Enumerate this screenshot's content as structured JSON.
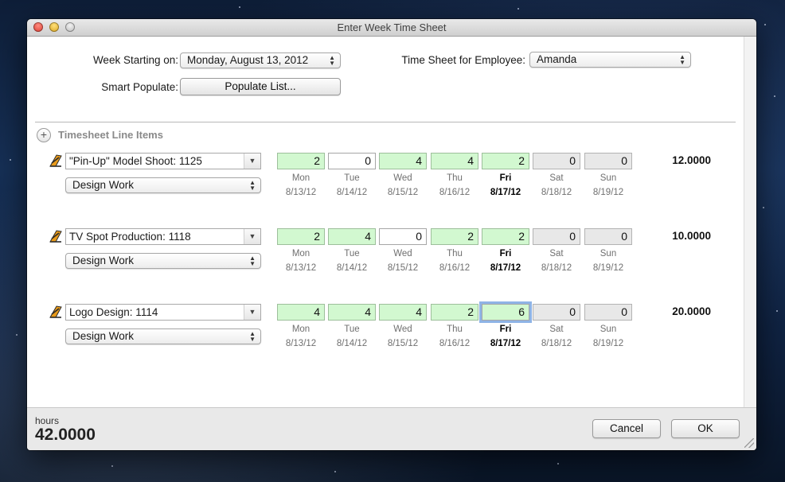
{
  "window": {
    "title": "Enter Week Time Sheet"
  },
  "header": {
    "week_label": "Week Starting on:",
    "week_value": "Monday, August 13, 2012",
    "employee_label": "Time Sheet for Employee:",
    "employee_value": "Amanda",
    "populate_label": "Smart Populate:",
    "populate_button": "Populate List..."
  },
  "section": {
    "title": "Timesheet Line Items"
  },
  "days": [
    {
      "day": "Mon",
      "date": "8/13/12"
    },
    {
      "day": "Tue",
      "date": "8/14/12"
    },
    {
      "day": "Wed",
      "date": "8/15/12"
    },
    {
      "day": "Thu",
      "date": "8/16/12"
    },
    {
      "day": "Fri",
      "date": "8/17/12"
    },
    {
      "day": "Sat",
      "date": "8/18/12"
    },
    {
      "day": "Sun",
      "date": "8/19/12"
    }
  ],
  "line_items": [
    {
      "project": "\"Pin-Up\" Model Shoot: 1125",
      "task": "Design Work",
      "hours": [
        "2",
        "0",
        "4",
        "4",
        "2",
        "0",
        "0"
      ],
      "total": "12.0000"
    },
    {
      "project": "TV Spot Production: 1118",
      "task": "Design Work",
      "hours": [
        "2",
        "4",
        "0",
        "2",
        "2",
        "0",
        "0"
      ],
      "total": "10.0000"
    },
    {
      "project": "Logo Design: 1114",
      "task": "Design Work",
      "hours": [
        "4",
        "4",
        "4",
        "2",
        "6",
        "0",
        "0"
      ],
      "total": "20.0000"
    }
  ],
  "footer": {
    "hours_label": "hours",
    "hours_total": "42.0000",
    "cancel_label": "Cancel",
    "ok_label": "OK"
  }
}
